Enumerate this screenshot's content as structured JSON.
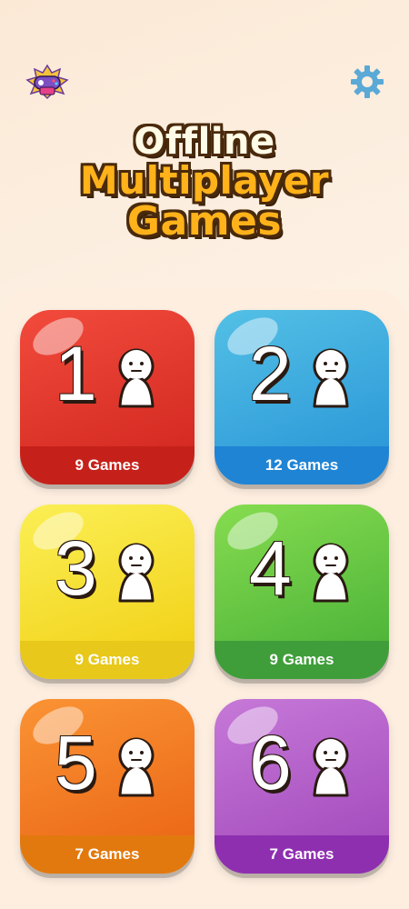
{
  "header": {
    "logo_icon": "controller-logo-icon",
    "settings_icon": "gear-icon",
    "title_lines": [
      "Offline",
      "Multiplayer",
      "Games"
    ]
  },
  "categories": [
    {
      "players": "1",
      "games_label": "9 Games",
      "color": "#d42a22"
    },
    {
      "players": "2",
      "games_label": "12 Games",
      "color": "#2d99d8"
    },
    {
      "players": "3",
      "games_label": "9 Games",
      "color": "#f2d31b"
    },
    {
      "players": "4",
      "games_label": "9 Games",
      "color": "#4fb53a"
    },
    {
      "players": "5",
      "games_label": "7 Games",
      "color": "#ec6918"
    },
    {
      "players": "6",
      "games_label": "7 Games",
      "color": "#a54dbe"
    }
  ]
}
